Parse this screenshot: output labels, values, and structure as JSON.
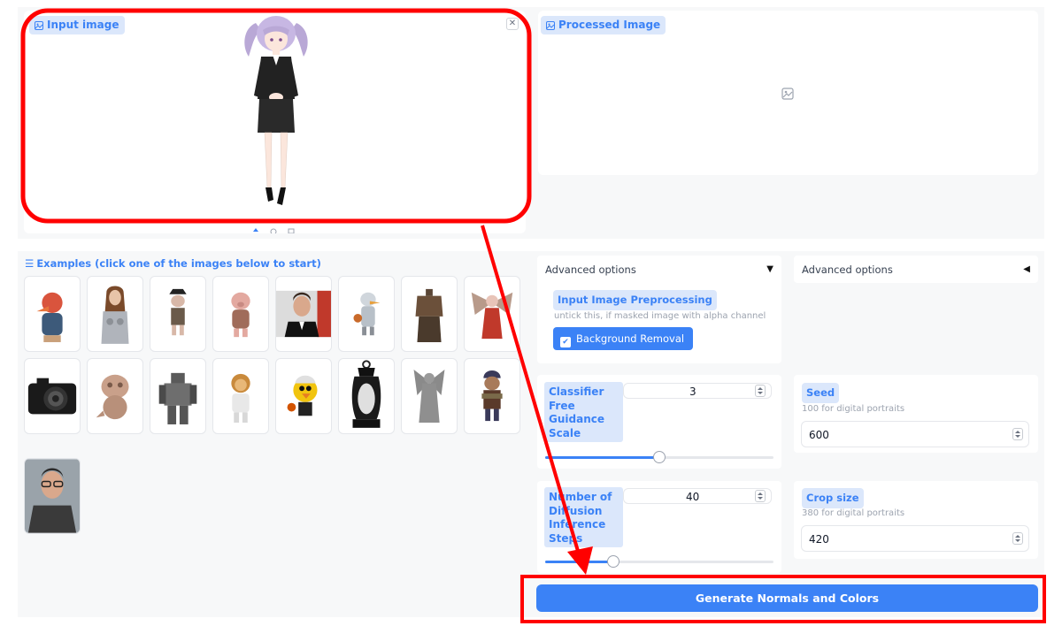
{
  "input_panel": {
    "label": "Input image"
  },
  "output_panel": {
    "label": "Processed Image"
  },
  "examples": {
    "title": "Examples (click one of the images below to start)",
    "items": [
      "red-hooded-duck",
      "female-cyborg",
      "pirate-pig",
      "pig-figure",
      "man-portrait",
      "duck-warrior",
      "armor-mannequin",
      "winged-figure",
      "camera",
      "clay-figure",
      "mech-robot",
      "astronaut-lion",
      "clown-bird",
      "lantern",
      "angel-statue",
      "samurai-monkey",
      "man-glasses-portrait"
    ]
  },
  "advanced_left": {
    "header": "Advanced options",
    "preprocess_label": "Input Image Preprocessing",
    "preprocess_hint": "untick this, if masked image with alpha channel",
    "bg_removal_label": "Background Removal",
    "bg_removal_checked": true
  },
  "advanced_right": {
    "header": "Advanced options"
  },
  "cfg": {
    "label": "Classifier Free Guidance Scale",
    "value": "3",
    "level": 0.5
  },
  "steps": {
    "label": "Number of Diffusion Inference Steps",
    "value": "40",
    "level": 0.3
  },
  "seed": {
    "label": "Seed",
    "hint": "100 for digital portraits",
    "value": "600"
  },
  "crop": {
    "label": "Crop size",
    "hint": "380 for digital portraits",
    "value": "420"
  },
  "generate": {
    "label": "Generate Normals and Colors"
  },
  "colors": {
    "accent": "#3b82f6",
    "annotation": "#ff0000",
    "badge_bg": "#dbe7fb"
  }
}
